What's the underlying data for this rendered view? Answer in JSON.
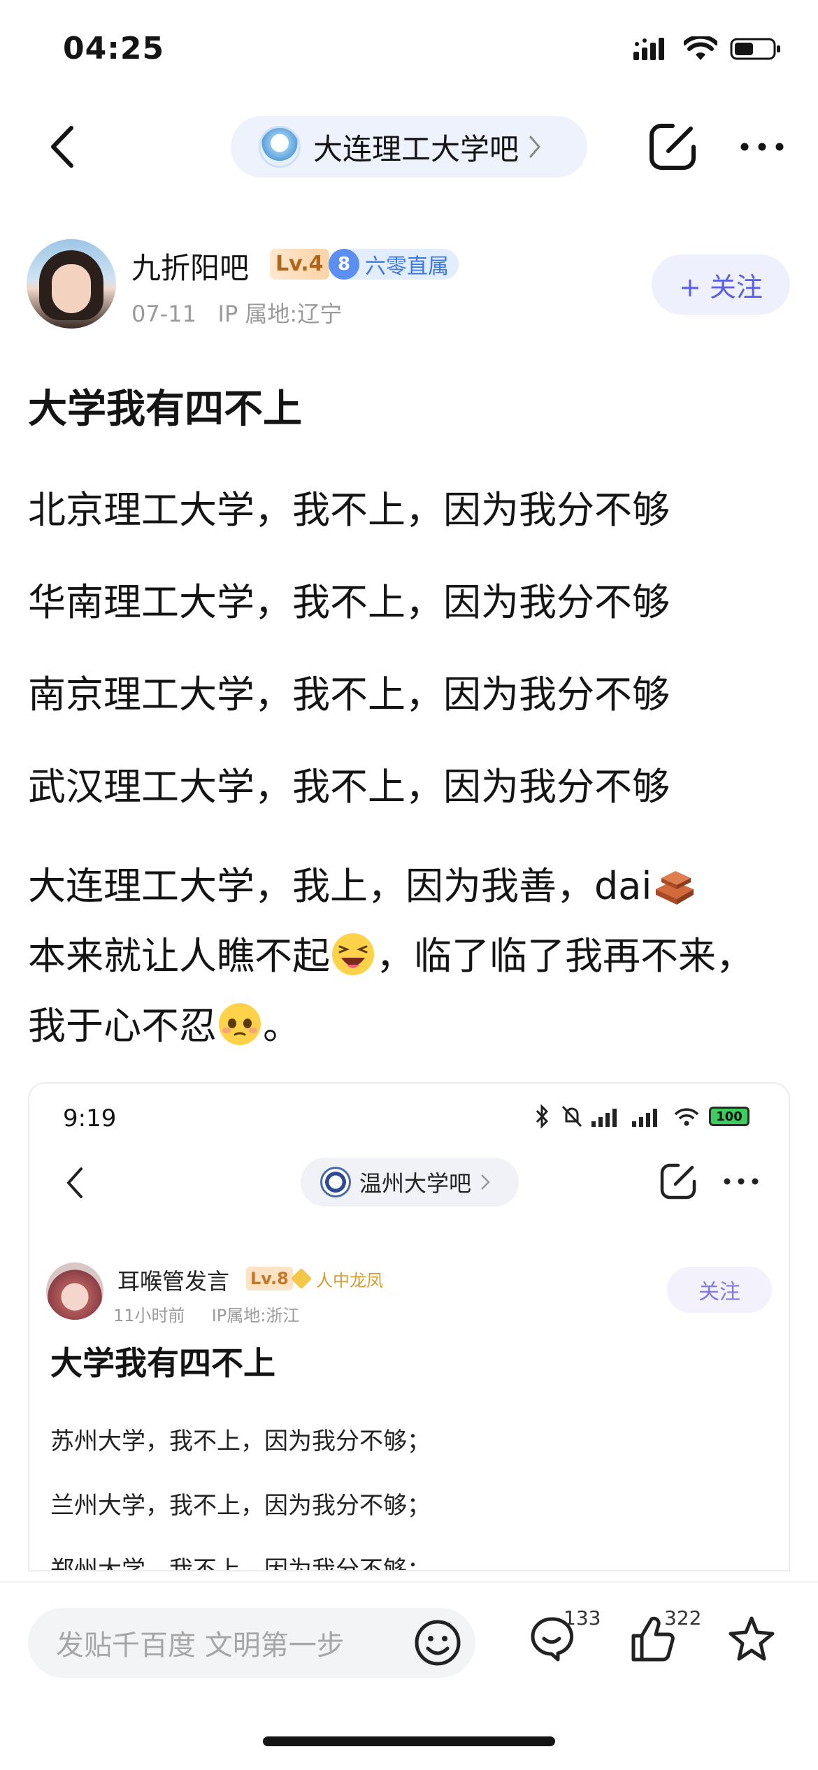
{
  "status_bar": {
    "time": "04:25"
  },
  "nav": {
    "forum_name": "大连理工大学吧"
  },
  "author": {
    "name": "九折阳吧",
    "level": "Lv.4",
    "member_number": "8",
    "member_label": "六零直属",
    "date": "07-11",
    "ip_location": "IP 属地:辽宁",
    "follow_label": "+ 关注"
  },
  "post": {
    "title": "大学我有四不上",
    "lines": [
      "北京理工大学，我不上，因为我分不够",
      "华南理工大学，我不上，因为我分不够",
      "南京理工大学，我不上，因为我分不够",
      "武汉理工大学，我不上，因为我分不够"
    ],
    "last_para": {
      "part1": "大连理工大学，我上，因为我善，dai",
      "part2": "本来就让人瞧不起",
      "part3": "，临了临了我再不来，我于心不忍",
      "part4": "。"
    }
  },
  "embedded_screenshot": {
    "time": "9:19",
    "battery": "100",
    "forum_name": "温州大学吧",
    "author_name": "耳喉管发言",
    "level": "Lv.8",
    "badge": "人中龙凤",
    "time_ago": "11小时前",
    "ip_location": "IP属地:浙江",
    "follow_label": "关注",
    "title": "大学我有四不上",
    "lines": [
      "苏州大学，我不上，因为我分不够；",
      "兰州大学，我不上，因为我分不够；",
      "郑州大学，我不上，因为我分不够；"
    ]
  },
  "bottom_bar": {
    "comment_placeholder": "发贴千百度 文明第一步",
    "comment_count": "133",
    "like_count": "322"
  },
  "icons": [
    "back-icon",
    "forum-logo",
    "edit-icon",
    "more-icon",
    "emoji-icon",
    "comment-icon",
    "like-icon",
    "star-icon",
    "brick-emoji",
    "laughing-emoji",
    "pleading-emoji"
  ]
}
